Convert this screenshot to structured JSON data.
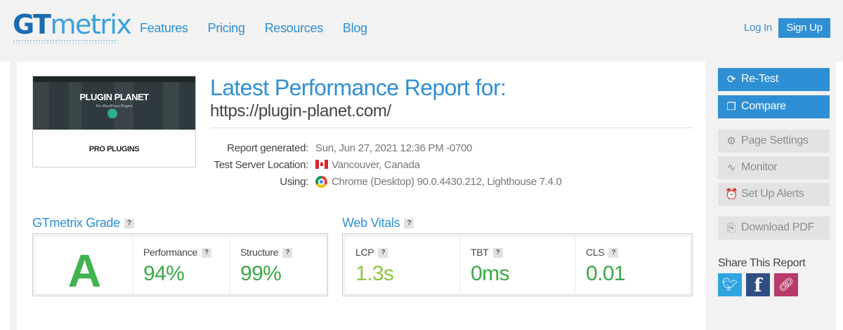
{
  "header": {
    "logo_gt": "GT",
    "logo_metrix": "metrix",
    "nav": [
      "Features",
      "Pricing",
      "Resources",
      "Blog"
    ],
    "login": "Log In",
    "signup": "Sign Up"
  },
  "thumbnail": {
    "title": "PLUGIN PLANET",
    "subtitle": "Pro WordPress Plugins",
    "bottom_label": "PRO PLUGINS"
  },
  "report": {
    "title": "Latest Performance Report for:",
    "url": "https://plugin-planet.com/",
    "meta": [
      {
        "label": "Report generated:",
        "value": "Sun, Jun 27, 2021 12:36 PM -0700",
        "icon": ""
      },
      {
        "label": "Test Server Location:",
        "value": "Vancouver, Canada",
        "icon": "canada-flag-icon"
      },
      {
        "label": "Using:",
        "value": "Chrome (Desktop) 90.0.4430.212, Lighthouse 7.4.0",
        "icon": "chrome-icon"
      }
    ]
  },
  "grade": {
    "title": "GTmetrix Grade",
    "letter": "A",
    "performance_label": "Performance",
    "performance_value": "94%",
    "structure_label": "Structure",
    "structure_value": "99%"
  },
  "vitals": {
    "title": "Web Vitals",
    "lcp_label": "LCP",
    "lcp_value": "1.3s",
    "tbt_label": "TBT",
    "tbt_value": "0ms",
    "cls_label": "CLS",
    "cls_value": "0.01"
  },
  "sidebar": {
    "retest": "Re-Test",
    "compare": "Compare",
    "page_settings": "Page Settings",
    "monitor": "Monitor",
    "alerts": "Set Up Alerts",
    "download_pdf": "Download PDF",
    "share_title": "Share This Report"
  },
  "help_mark": "?",
  "colors": {
    "brand_blue": "#2f8fd4",
    "grade_green": "#3fb34f",
    "value_green": "#3aa845",
    "lcp_green": "#8cc63f",
    "disabled_grey": "#e3e3e3"
  }
}
